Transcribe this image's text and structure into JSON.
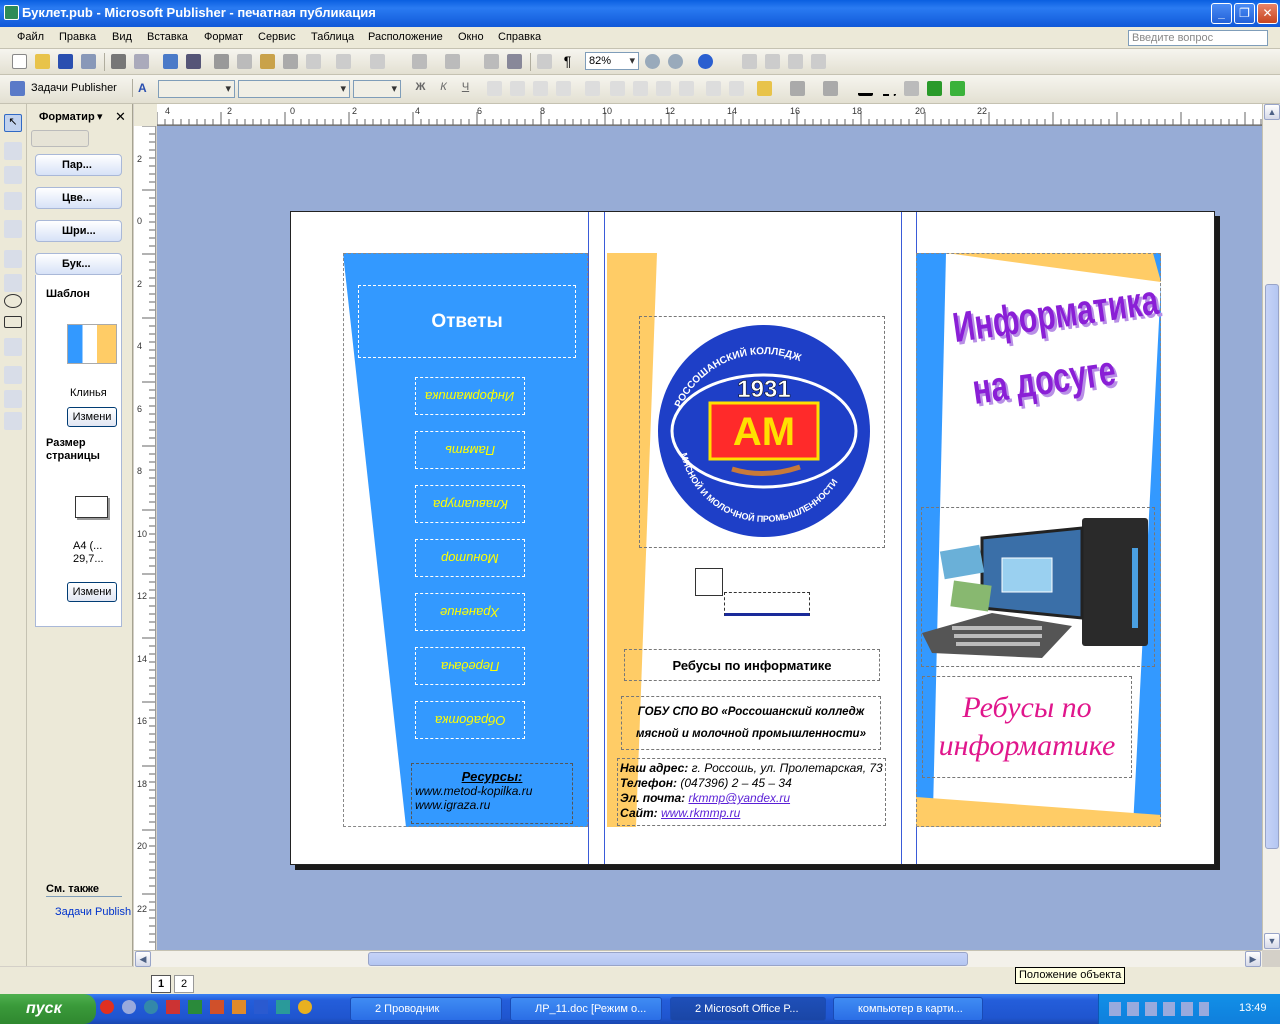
{
  "window": {
    "title": "Буклет.pub - Microsoft Publisher - печатная публикация"
  },
  "menu": [
    "Файл",
    "Правка",
    "Вид",
    "Вставка",
    "Формат",
    "Сервис",
    "Таблица",
    "Расположение",
    "Окно",
    "Справка"
  ],
  "ask_placeholder": "Введите вопрос",
  "toolbar": {
    "zoom": "82%",
    "tasks_label": "Задачи Publisher"
  },
  "taskpane": {
    "title": "Форматир",
    "sections": [
      "Пар...",
      "Цве...",
      "Шри...",
      "Бук..."
    ],
    "template_label": "Шаблон",
    "template_name": "Клинья",
    "change_label": "Измени",
    "pagesize_label": "Размер страницы",
    "pagesize_value": "А4 (... 29,7...",
    "see_also": "См. также",
    "see_also_link": "Задачи Publish"
  },
  "rulers": {
    "h": [
      "4",
      "2",
      "0",
      "2",
      "4",
      "6",
      "8",
      "10",
      "12",
      "14",
      "16",
      "18",
      "20",
      "22"
    ],
    "v": [
      "2",
      "0",
      "2",
      "4",
      "6",
      "8",
      "10",
      "12",
      "14",
      "16",
      "18",
      "20",
      "22"
    ]
  },
  "booklet": {
    "answers_title": "Ответы",
    "answers": [
      "Информатика",
      "Память",
      "Клавиатура",
      "Монитор",
      "Хранение",
      "Передача",
      "Обработка"
    ],
    "resources_title": "Ресурсы:",
    "resources": [
      "www.metod-kopilka.ru",
      "www.igraza.ru"
    ],
    "logo_year": "1931",
    "logo_top": "РОССОШАНСКИЙ КОЛЛЕДЖ",
    "logo_bottom": "МЯСНОЙ И МОЛОЧНОЙ ПРОМЫШЛЕННОСТИ",
    "logo_mark": "АМ",
    "rebus_heading": "Ребусы по информатике",
    "org_name": "ГОБУ СПО ВО «Россошанский колледж мясной и молочной промышленности»",
    "address_label": "Наш адрес:",
    "address": "г. Россошь, ул. Пролетарская, 73",
    "phone_label": "Телефон:",
    "phone": "(047396) 2 – 45 – 34",
    "email_label": "Эл. почта:",
    "email": "rkmmp@yandex.ru",
    "site_label": "Сайт:",
    "site": "www.rkmmp.ru",
    "cover_line1": "Информатика",
    "cover_line2": "на досуге",
    "cover_subtitle": "Ребусы по информатике"
  },
  "pages": [
    "1",
    "2"
  ],
  "tooltip": "Положение объекта",
  "taskbar": {
    "start": "пуск",
    "tasks": [
      "2 Проводник",
      "ЛР_11.doc [Режим о...",
      "2 Microsoft Office P...",
      "компьютер в карти..."
    ],
    "clock": "13:49"
  },
  "colors": {
    "blue": "#3399ff",
    "yellow": "#ffcc66",
    "purple": "#8a1fd6",
    "magenta": "#e0168c"
  }
}
